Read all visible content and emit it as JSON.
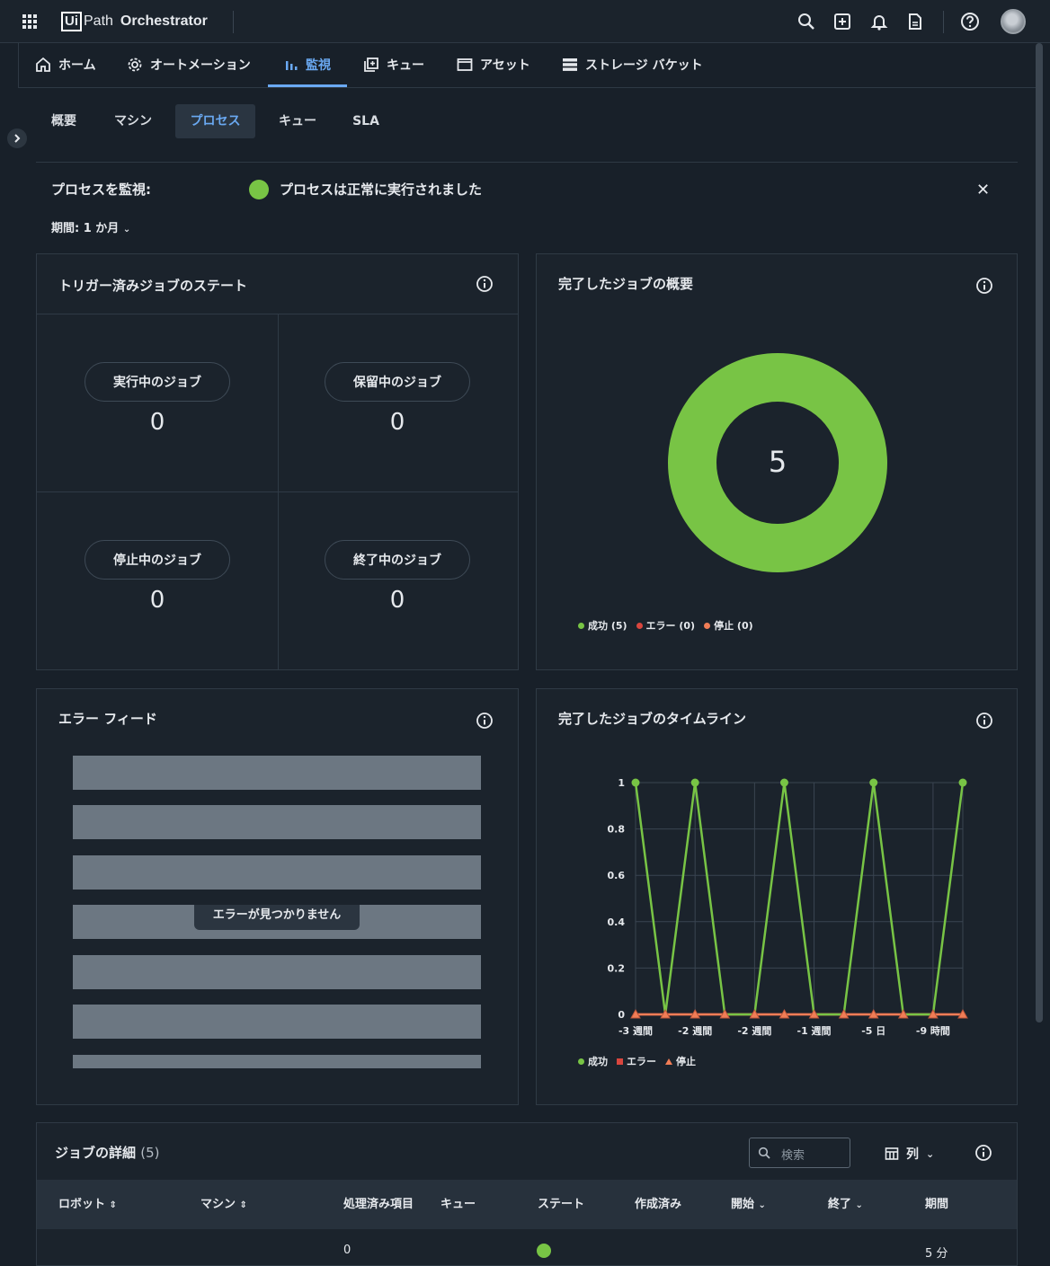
{
  "app": {
    "brand_ui": "Ui",
    "brand_path": "Path",
    "brand_product": "Orchestrator"
  },
  "icons": {
    "apps": "apps-grid-icon",
    "search": "search-icon",
    "add": "add-icon",
    "notifications": "bell-icon",
    "document": "document-icon",
    "help": "help-icon"
  },
  "nav": {
    "home": "ホーム",
    "automation": "オートメーション",
    "monitor": "監視",
    "queues": "キュー",
    "assets": "アセット",
    "storage": "ストレージ バケット"
  },
  "subtabs": {
    "overview": "概要",
    "machines": "マシン",
    "processes": "プロセス",
    "queues": "キュー",
    "sla": "SLA"
  },
  "monitor": {
    "label": "プロセスを監視:",
    "status": "プロセスは正常に実行されました",
    "period": "期間: 1 か月"
  },
  "triggered": {
    "title": "トリガー済みジョブのステート",
    "running_label": "実行中のジョブ",
    "running_value": "0",
    "pending_label": "保留中のジョブ",
    "pending_value": "0",
    "stopping_label": "停止中のジョブ",
    "stopping_value": "0",
    "terminating_label": "終了中のジョブ",
    "terminating_value": "0"
  },
  "completed_summary": {
    "title": "完了したジョブの概要",
    "total": "5",
    "legend_success": "成功 (5)",
    "legend_error": "エラー (0)",
    "legend_stopped": "停止 (0)"
  },
  "error_feed": {
    "title": "エラー フィード",
    "empty": "エラーが見つかりません"
  },
  "timeline": {
    "title": "完了したジョブのタイムライン",
    "legend_success": "成功",
    "legend_error": "エラー",
    "legend_stopped": "停止"
  },
  "chart_data": {
    "type": "line",
    "title": "完了したジョブのタイムライン",
    "ylim": [
      0,
      1
    ],
    "yticks": [
      "0",
      "0.2",
      "0.4",
      "0.6",
      "0.8",
      "1"
    ],
    "xtick_labels": [
      "-3 週間",
      "-2 週間",
      "-2 週間",
      "-1 週間",
      "-5 日",
      "-9 時間"
    ],
    "grid": true,
    "legend_placement": "bottom-left",
    "series": [
      {
        "name": "成功",
        "color": "#78c445",
        "values": [
          1,
          0,
          1,
          0,
          0,
          1,
          0,
          0,
          1,
          0,
          0,
          1
        ]
      },
      {
        "name": "エラー",
        "color": "#d9463e",
        "values": [
          0,
          0,
          0,
          0,
          0,
          0,
          0,
          0,
          0,
          0,
          0,
          0
        ]
      },
      {
        "name": "停止",
        "color": "#f07d56",
        "values": [
          0,
          0,
          0,
          0,
          0,
          0,
          0,
          0,
          0,
          0,
          0,
          0
        ]
      }
    ]
  },
  "donut": {
    "success": 5,
    "error": 0,
    "stopped": 0,
    "colors": {
      "success": "#78c445",
      "error": "#d9463e",
      "stopped": "#f07d56"
    }
  },
  "jobs": {
    "title": "ジョブの詳細",
    "count": "(5)",
    "search_placeholder": "検索",
    "columns_label": "列",
    "headers": [
      "ロボット",
      "マシン",
      "処理済み項目",
      "キュー",
      "ステート",
      "作成済み",
      "開始",
      "終了",
      "期間"
    ],
    "row1": {
      "processed": "0",
      "duration": "5 分"
    }
  }
}
